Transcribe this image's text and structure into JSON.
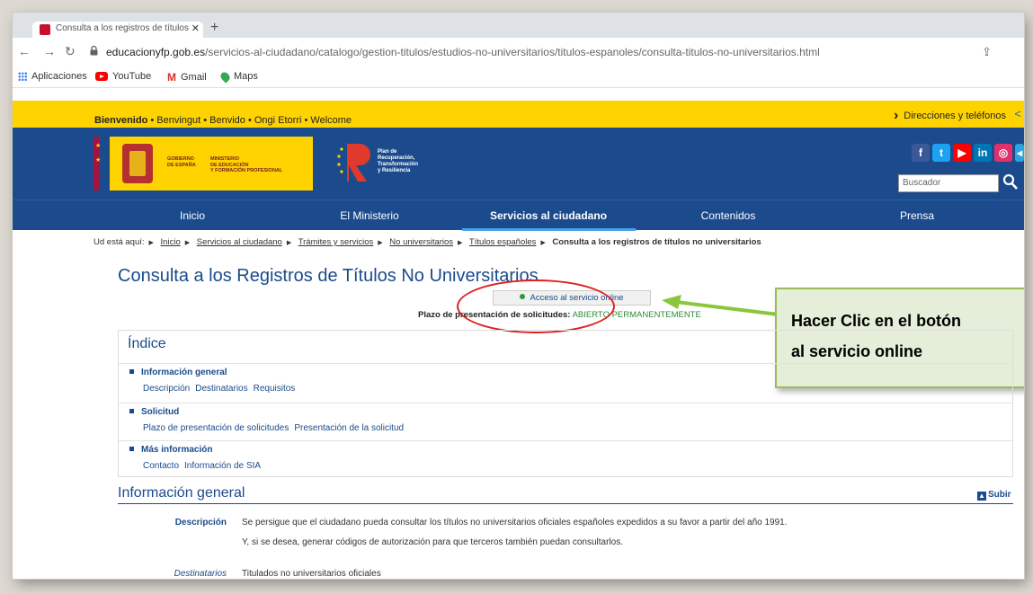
{
  "browser": {
    "tab_title": "Consulta a los registros de títulos",
    "url_domain": "educacionyfp.gob.es",
    "url_path": "/servicios-al-ciudadano/catalogo/gestion-titulos/estudios-no-universitarios/titulos-espanoles/consulta-titulos-no-universitarios.html",
    "bookmarks": [
      "Aplicaciones",
      "YouTube",
      "Gmail",
      "Maps"
    ]
  },
  "welcome": {
    "bold": "Bienvenido",
    "rest": " • Benvingut • Benvido • Ongi Etorri • Welcome",
    "directions": "Direcciones y teléfonos"
  },
  "header": {
    "gob_left": "GOBIERNO\nDE ESPAÑA",
    "gob_right": "MINISTERIO\nDE EDUCACIÓN\nY FORMACIÓN PROFESIONAL",
    "plan": "Plan de\nRecuperación,\nTransformación\ny Resiliencia",
    "search_placeholder": "Buscador",
    "colors": {
      "navy": "#1b4b8c",
      "yellow": "#ffd300"
    }
  },
  "nav": {
    "items": [
      "Inicio",
      "El Ministerio",
      "Servicios al ciudadano",
      "Contenidos",
      "Prensa"
    ],
    "active": "Servicios al ciudadano"
  },
  "breadcrumb": {
    "prefix": "Ud está aquí:",
    "links": [
      "Inicio",
      "Servicios al ciudadano",
      "Trámites y servicios",
      "No universitarios",
      "Títulos españoles"
    ],
    "current": "Consulta a los registros de títulos no universitarios"
  },
  "page": {
    "title": "Consulta a los Registros de Títulos No Universitarios",
    "access_button": "Acceso al servicio online",
    "plazo_label": "Plazo de presentación de solicitudes:",
    "plazo_value": "ABIERTO PERMANENTEMENTE"
  },
  "callout": "Hacer Clic en el botón\nal servicio online",
  "indice": {
    "title": "Índice",
    "sections": [
      {
        "head": "Información general",
        "links": [
          "Descripción",
          "Destinatarios",
          "Requisitos"
        ]
      },
      {
        "head": "Solicitud",
        "links": [
          "Plazo de presentación de solicitudes",
          "Presentación de la solicitud"
        ]
      },
      {
        "head": "Más información",
        "links": [
          "Contacto",
          "Información de SIA"
        ]
      }
    ]
  },
  "info": {
    "title": "Información general",
    "subir": "Subir",
    "descripcion_label": "Descripción",
    "descripcion_1": "Se persigue que el ciudadano pueda consultar los títulos no universitarios oficiales españoles expedidos a su favor a partir del año 1991.",
    "descripcion_2": "Y, si se desea, generar códigos de autorización para que terceros también puedan consultarlos.",
    "destinatarios_label": "Destinatarios",
    "destinatarios": "Titulados no universitarios oficiales"
  }
}
